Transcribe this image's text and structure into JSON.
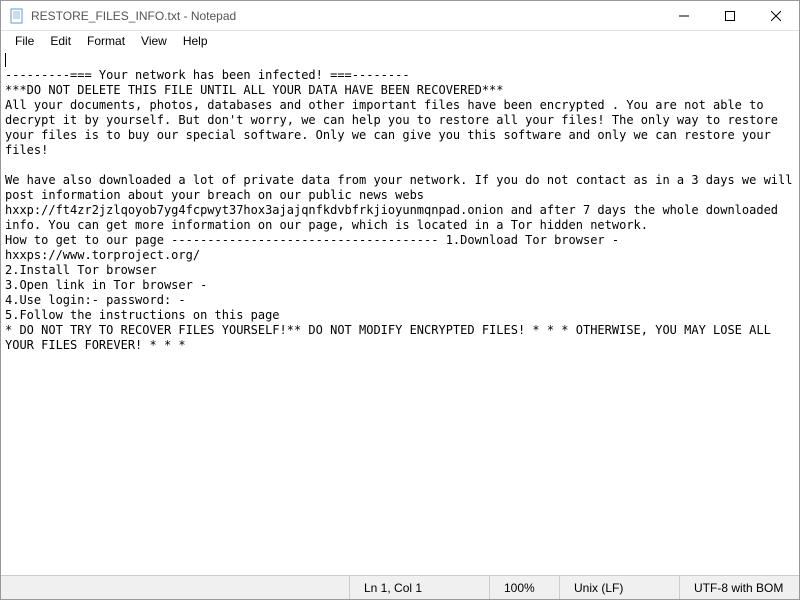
{
  "window": {
    "title": "RESTORE_FILES_INFO.txt - Notepad"
  },
  "menu": {
    "file": "File",
    "edit": "Edit",
    "format": "Format",
    "view": "View",
    "help": "Help"
  },
  "content": "\n---------=== Your network has been infected! ===--------\n***DO NOT DELETE THIS FILE UNTIL ALL YOUR DATA HAVE BEEN RECOVERED***\nAll your documents, photos, databases and other important files have been encrypted . You are not able to decrypt it by yourself. But don't worry, we can help you to restore all your files! The only way to restore your files is to buy our special software. Only we can give you this software and only we can restore your files!\n\nWe have also downloaded a lot of private data from your network. If you do not contact as in a 3 days we will post information about your breach on our public news webs hxxp://ft4zr2jzlqoyob7yg4fcpwyt37hox3ajajqnfkdvbfrkjioyunmqnpad.onion and after 7 days the whole downloaded info. You can get more information on our page, which is located in a Tor hidden network.\nHow to get to our page ------------------------------------- 1.Download Tor browser - hxxps://www.torproject.org/\n2.Install Tor browser\n3.Open link in Tor browser -\n4.Use login:- password: -\n5.Follow the instructions on this page\n* DO NOT TRY TO RECOVER FILES YOURSELF!** DO NOT MODIFY ENCRYPTED FILES! * * * OTHERWISE, YOU MAY LOSE ALL YOUR FILES FOREVER! * * *",
  "statusbar": {
    "position": "Ln 1, Col 1",
    "zoom": "100%",
    "line_ending": "Unix (LF)",
    "encoding": "UTF-8 with BOM"
  }
}
